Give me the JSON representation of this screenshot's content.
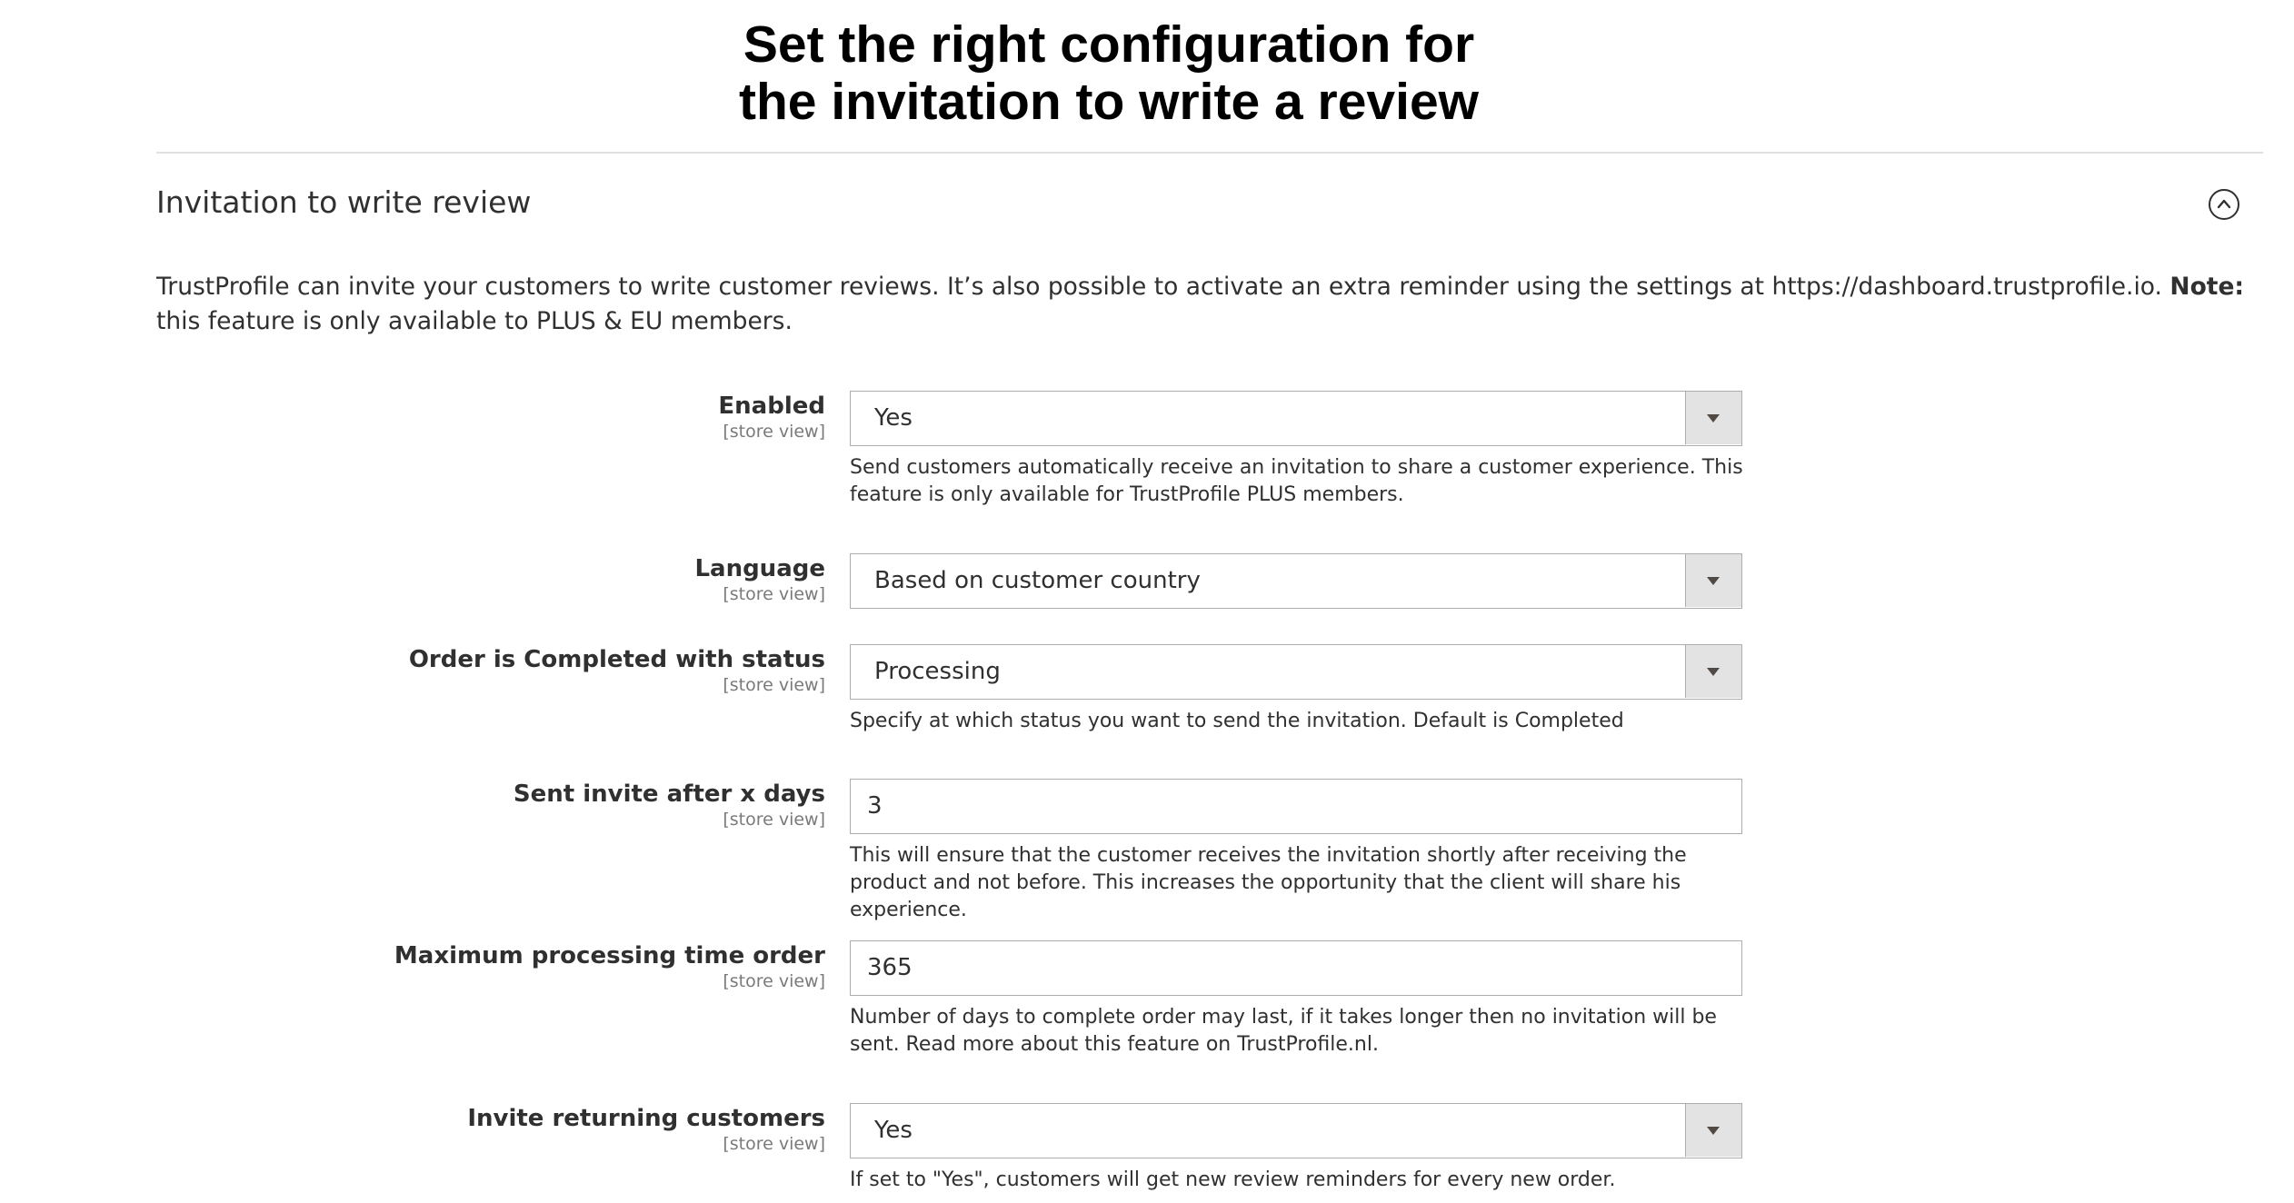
{
  "headline": {
    "line1": "Set the right configuration for",
    "line2": "the invitation to write a review"
  },
  "section": {
    "title": "Invitation to write review",
    "collapse_icon": "chevron-up-circle-icon",
    "intro_before_note": "TrustProfile can invite your customers to write customer reviews. It’s also possible to activate an extra reminder using the settings at https://dashboard.trustprofile.io. ",
    "intro_note_label": "Note:",
    "intro_after_note": " this feature is only available to PLUS & EU members."
  },
  "fields": [
    {
      "label": "Enabled",
      "scope": "[store view]",
      "type": "select",
      "value": "Yes",
      "note": "Send customers automatically receive an invitation to share a customer experience. This feature is only available for TrustProfile PLUS members."
    },
    {
      "label": "Language",
      "scope": "[store view]",
      "type": "select",
      "value": "Based on customer country",
      "note": ""
    },
    {
      "label": "Order is Completed with status",
      "scope": "[store view]",
      "type": "select",
      "value": "Processing",
      "note": "Specify at which status you want to send the invitation. Default is Completed"
    },
    {
      "label": "Sent invite after x days",
      "scope": "[store view]",
      "type": "text",
      "value": "3",
      "note": "This will ensure that the customer receives the invitation shortly after receiving the product and not before. This increases the opportunity that the client will share his experience."
    },
    {
      "label": "Maximum processing time order",
      "scope": "[store view]",
      "type": "text",
      "value": "365",
      "note": "Number of days to complete order may last, if it takes longer then no invitation will be sent. Read more about this feature on TrustProfile.nl."
    },
    {
      "label": "Invite returning customers",
      "scope": "[store view]",
      "type": "select",
      "value": "Yes",
      "note": "If set to \"Yes\", customers will get new review reminders for every new order."
    }
  ]
}
